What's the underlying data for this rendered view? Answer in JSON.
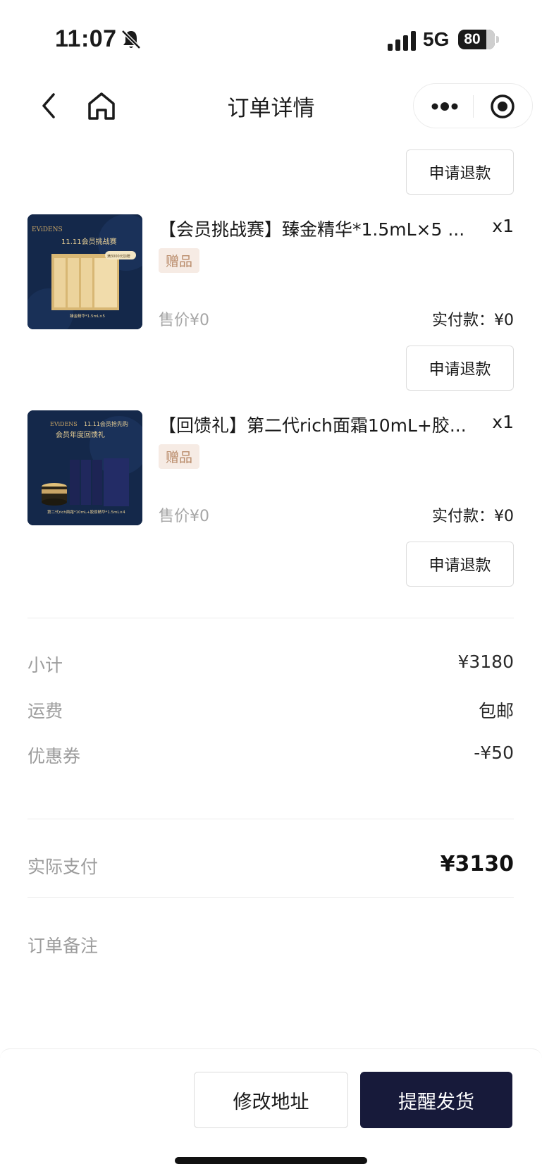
{
  "status_bar": {
    "time": "11:07",
    "network": "5G",
    "battery": "80"
  },
  "nav": {
    "title": "订单详情"
  },
  "refund_label": "申请退款",
  "products": [
    {
      "title": "【会员挑战赛】臻金精华*1.5mL×5 ...",
      "qty": "x1",
      "tag": "赠品",
      "price": "售价¥0",
      "paid": "实付款：¥0",
      "thumb": {
        "brand": "EViDENS",
        "headline": "11.11会员挑战赛",
        "badge": "满3000元加赠",
        "caption": "臻金精华*1.5mL×5"
      }
    },
    {
      "title": "【回馈礼】第二代rich面霜10mL+胶...",
      "qty": "x1",
      "tag": "赠品",
      "price": "售价¥0",
      "paid": "实付款：¥0",
      "thumb": {
        "brand": "EViDENS",
        "headline": "11.11会员抢先购",
        "subheadline": "会员年度回馈礼",
        "caption": "第二代rich面霜*10mL+胶原精华*1.5mL×4"
      }
    }
  ],
  "summary": {
    "subtotal_label": "小计",
    "subtotal_value": "¥3180",
    "shipping_label": "运费",
    "shipping_value": "包邮",
    "coupon_label": "优惠券",
    "coupon_value": "-¥50",
    "total_label": "实际支付",
    "total_value": "¥3130",
    "note_label": "订单备注"
  },
  "actions": {
    "modify_address": "修改地址",
    "remind_shipping": "提醒发货"
  },
  "colors": {
    "primary_button": "#171a3a",
    "gift_tag_bg": "#f6ebe4",
    "gift_tag_text": "#b98b6a",
    "thumb_bg": "#14284a",
    "thumb_gold": "#c9a566"
  }
}
